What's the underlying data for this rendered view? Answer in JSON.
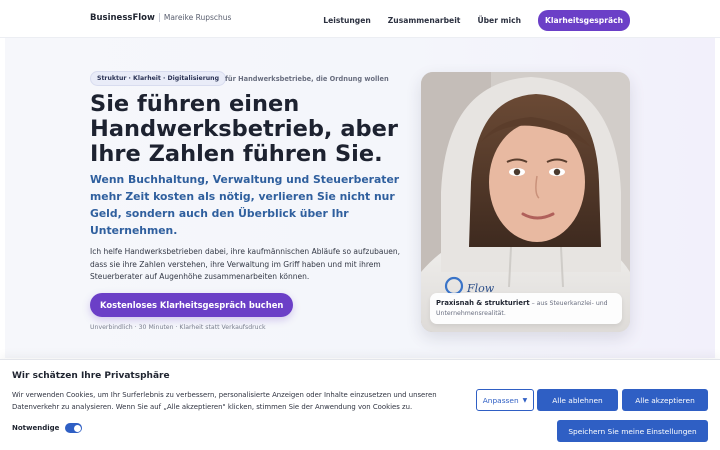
{
  "nav": {
    "brand": "BusinessFlow",
    "brand_sub": "Mareike Rupschus",
    "links": [
      "Leistungen",
      "Zusammenarbeit",
      "Über mich"
    ],
    "cta": "Klarheitsgespräch"
  },
  "hero": {
    "pill": "Struktur · Klarheit · Digitalisierung",
    "pill_note": "für Handwerksbetriebe, die Ordnung wollen",
    "headline": "Sie führen einen Handwerksbetrieb, aber Ihre Zahlen führen Sie.",
    "subhead": "Wenn Buchhaltung, Verwaltung und Steuerberater mehr Zeit kosten als nötig, verlieren Sie nicht nur Geld, sondern auch den Überblick über Ihr Unternehmen.",
    "body": "Ich helfe Handwerksbetrieben dabei, ihre kaufmännischen Abläufe so aufzubauen, dass sie ihre Zahlen verstehen, ihre Verwaltung im Griff haben und mit ihrem Steuerberater auf Augenhöhe zusammenarbeiten können.",
    "cta": "Kostenloses Klarheitsgespräch buchen",
    "cta_note": "Unverbindlich · 30 Minuten · Klarheit statt Verkaufsdruck"
  },
  "photo": {
    "caption_strong": "Praxisnah & strukturiert",
    "caption_rest": "– aus Steuerkanzlei- und Unternehmensrealität.",
    "shirt_logo": "Flow"
  },
  "cookie": {
    "title": "Wir schätzen Ihre Privatsphäre",
    "text": "Wir verwenden Cookies, um Ihr Surferlebnis zu verbessern, personalisierte Anzeigen oder Inhalte einzusetzen und unseren Datenverkehr zu analysieren. Wenn Sie auf „Alle akzeptieren\" klicken, stimmen Sie der Anwendung von Cookies zu.",
    "necessary_label": "Notwendige",
    "customize": "Anpassen",
    "reject": "Alle ablehnen",
    "accept": "Alle akzeptieren",
    "save": "Speichern Sie meine Einstellungen"
  },
  "colors": {
    "accent_purple": "#6b3fc7",
    "accent_blue": "#2f5fc4",
    "subhead_blue": "#2f5f9e"
  }
}
